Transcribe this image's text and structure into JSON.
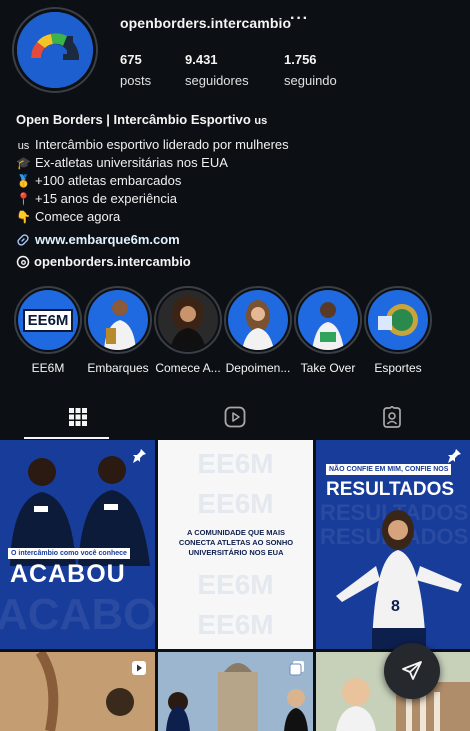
{
  "profile": {
    "username": "openborders.intercambio",
    "more_label": "···",
    "stats": [
      {
        "value": "675",
        "label": "posts"
      },
      {
        "value": "9.431",
        "label": "seguidores"
      },
      {
        "value": "1.756",
        "label": "seguindo"
      }
    ],
    "display_name": "Open Borders | Intercâmbio Esportivo ",
    "display_name_flag": "us",
    "bio_lines": [
      {
        "icon": "us",
        "text": "Intercâmbio esportivo liderado por mulheres"
      },
      {
        "icon": "🎓",
        "text": "Ex-atletas universitárias nos EUA"
      },
      {
        "icon": "🥇",
        "text": "+100 atletas embarcados"
      },
      {
        "icon": "📍",
        "text": "+15 anos de experiência"
      },
      {
        "icon": "👇",
        "text": "Comece agora"
      }
    ],
    "website": "www.embarque6m.com",
    "threads_handle": "openborders.intercambio"
  },
  "highlights": [
    {
      "label": "EE6M",
      "badge": "EE6M"
    },
    {
      "label": "Embarques"
    },
    {
      "label": "Comece A..."
    },
    {
      "label": "Depoimen..."
    },
    {
      "label": "Take Over"
    },
    {
      "label": "Esportes"
    }
  ],
  "tabs": [
    {
      "name": "posts-grid-icon"
    },
    {
      "name": "reels-icon"
    },
    {
      "name": "tagged-icon"
    }
  ],
  "posts": {
    "post1": {
      "caption": "O intercâmbio como você conhece",
      "headline": "ACABOU",
      "watermark": "ACABOU"
    },
    "post2": {
      "watermark": "EE6M",
      "text": "A COMUNIDADE QUE MAIS CONECTA ATLETAS AO SONHO UNIVERSITÁRIO NOS EUA"
    },
    "post3": {
      "kicker": "NÃO CONFIE EM MIM, CONFIE NOS",
      "headline": "RESULTADOS",
      "watermark": "RESULTADOS",
      "jersey": "8"
    }
  },
  "colors": {
    "background": "#0c1014",
    "accent_blue": "#1f6ae0",
    "link": "#e0f1ff",
    "navy": "#0d1f4d"
  }
}
